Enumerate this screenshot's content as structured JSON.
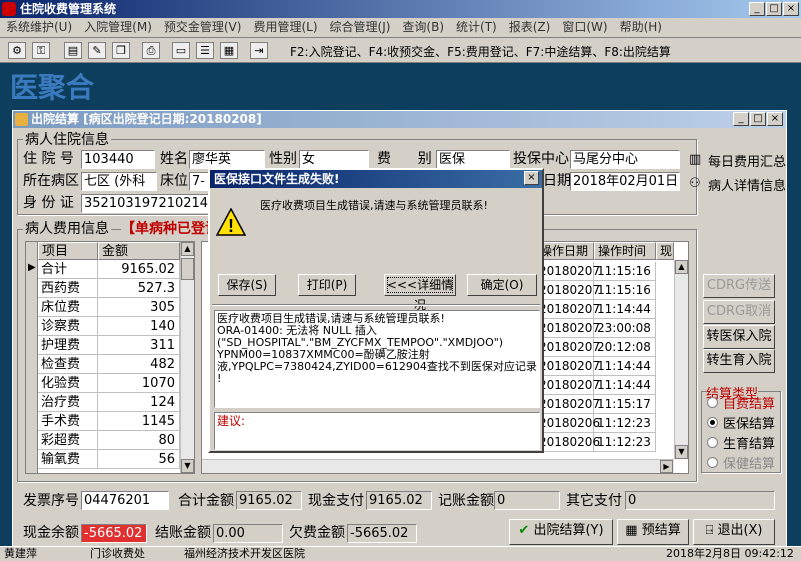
{
  "app": {
    "title": "住院收费管理系统"
  },
  "menu": [
    "系统维护(U)",
    "入院管理(M)",
    "预交金管理(V)",
    "费用管理(L)",
    "综合管理(J)",
    "查询(B)",
    "统计(T)",
    "报表(Z)",
    "窗口(W)",
    "帮助(H)"
  ],
  "toolbar": {
    "hint": "F2:入院登记、F4:收预交金、F5:费用登记、F7:中途结算、F8:出院结算"
  },
  "logo": {
    "text": "医聚合"
  },
  "window": {
    "title": "出院结算 [病区出院登记日期:20180208]"
  },
  "patient": {
    "section": "病人住院信息",
    "admission_no_label": "住 院 号",
    "admission_no": "103440",
    "name_label": "姓名",
    "name": "廖华英",
    "gender_label": "性别",
    "gender": "女",
    "fee_type_label": "费      别",
    "fee_type": "医保",
    "insurer_label": "投保中心",
    "insurer": "马尾分中心",
    "ward_label": "所在病区",
    "ward": "七区 (外科",
    "bed_label": "床位",
    "bed": "7-",
    "date_label": "日期",
    "date": "2018年02月01日",
    "id_label": "身 份 证",
    "id": "352103197210214524"
  },
  "side_links": {
    "daily": "每日费用汇总",
    "detail": "病人详情信息"
  },
  "fees": {
    "section": "病人费用信息",
    "warning": "【单病种已登记",
    "headers": [
      "项目",
      "金额"
    ],
    "rows": [
      {
        "item": "合计",
        "amount": "9165.02"
      },
      {
        "item": "西药费",
        "amount": "527.3"
      },
      {
        "item": "床位费",
        "amount": "305"
      },
      {
        "item": "诊察费",
        "amount": "140"
      },
      {
        "item": "护理费",
        "amount": "311"
      },
      {
        "item": "检查费",
        "amount": "482"
      },
      {
        "item": "化验费",
        "amount": "1070"
      },
      {
        "item": "治疗费",
        "amount": "124"
      },
      {
        "item": "手术费",
        "amount": "1145"
      },
      {
        "item": "彩超费",
        "amount": "80"
      },
      {
        "item": "输氧费",
        "amount": "56"
      }
    ]
  },
  "ops": {
    "headers": [
      "操作日期",
      "操作时间",
      "现"
    ],
    "rows": [
      {
        "date": "20180207",
        "time": "11:15:16"
      },
      {
        "date": "20180207",
        "time": "11:15:16"
      },
      {
        "date": "20180207",
        "time": "11:14:44"
      },
      {
        "date": "20180207",
        "time": "23:00:08"
      },
      {
        "date": "20180207",
        "time": "20:12:08"
      },
      {
        "date": "20180207",
        "time": "11:14:44"
      },
      {
        "date": "20180207",
        "time": "11:14:44"
      },
      {
        "date": "20180207",
        "time": "11:15:17"
      },
      {
        "date": "20180206",
        "time": "11:12:23"
      },
      {
        "date": "20180206",
        "time": "11:12:23"
      }
    ]
  },
  "right_buttons": {
    "cdrg_send": "CDRG传送",
    "cdrg_cancel": "CDRG取消",
    "to_insured": "转医保入院",
    "to_maternity": "转生育入院"
  },
  "settle_type": {
    "title": "结算类型",
    "options": [
      "自费结算",
      "医保结算",
      "生育结算",
      "保健结算"
    ]
  },
  "totals": {
    "invoice_label": "发票序号",
    "invoice": "04476201",
    "total_label": "合计金额",
    "total": "9165.02",
    "cash_label": "现金支付",
    "cash": "9165.02",
    "account_label": "记账金额",
    "account": "0",
    "other_label": "其它支付",
    "other": "0"
  },
  "bottom": {
    "cur_label": "现金余额",
    "cur": "-5665.02",
    "settle_label": "结账金额",
    "settle": "0.00",
    "owe_label": "欠费金额",
    "owe": "-5665.02",
    "discharge_btn": "出院结算(Y)",
    "pre_btn": "预结算",
    "exit_btn": "退出(X)"
  },
  "status": {
    "user": "黄建萍",
    "dept": "门诊收费处",
    "hospital": "福州经济技术开发区医院",
    "datetime": "2018年2月8日 09:42:12"
  },
  "dialog": {
    "title": "医保接口文件生成失败!",
    "message": "医疗收费项目生成错误,请速与系统管理员联系!",
    "buttons": {
      "save": "保存(S)",
      "print": "打印(P)",
      "details": "<<<详细情况",
      "ok": "确定(O)"
    },
    "detail_lines": [
      "医疗收费项目生成错误,请速与系统管理员联系!",
      "ORA-01400: 无法将 NULL 插入",
      "(\"SD_HOSPITAL\".\"BM_ZYCFMX_TEMPOO\".\"XMDJOO\")",
      "YPNM00=10837XMMC00=酚磺乙胺注射",
      "液,YPQLPC=7380424,ZYID00=612904查找不到医保对应记录",
      "!"
    ],
    "suggest_label": "建议:"
  }
}
